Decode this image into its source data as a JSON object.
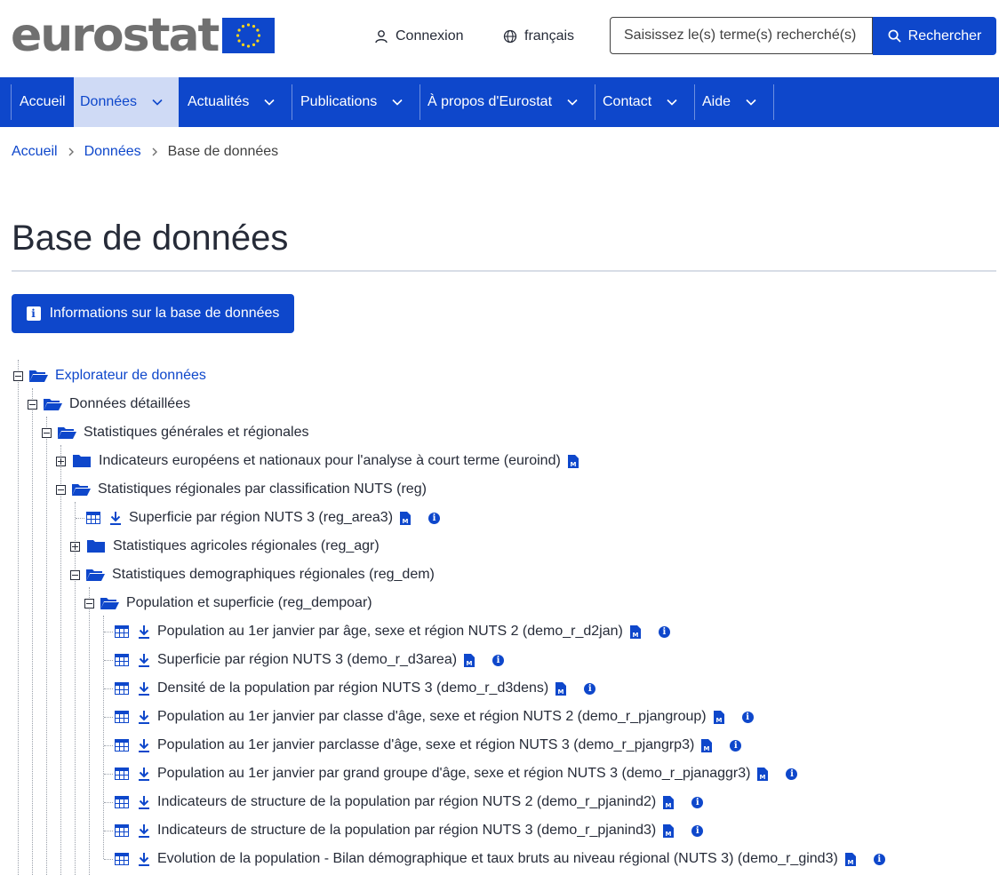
{
  "header": {
    "logo_text": "eurostat",
    "login_label": "Connexion",
    "language_label": "français",
    "search_placeholder": "Saisissez le(s) terme(s) recherché(s)",
    "search_button": "Rechercher"
  },
  "nav": {
    "items": [
      {
        "label": "Accueil"
      },
      {
        "label": "Données"
      },
      {
        "label": "Actualités"
      },
      {
        "label": "Publications"
      },
      {
        "label": "À propos d'Eurostat"
      },
      {
        "label": "Contact"
      },
      {
        "label": "Aide"
      }
    ]
  },
  "breadcrumb": {
    "items": [
      "Accueil",
      "Données",
      "Base de données"
    ]
  },
  "page_title": "Base de données",
  "info_button": "Informations sur la base de données",
  "tree": {
    "explorer": "Explorateur de données",
    "detailed": "Données détaillées",
    "general": "Statistiques générales et régionales",
    "euroind": "Indicateurs européens et nationaux pour l'analyse à court terme (euroind)",
    "reg": "Statistiques régionales par classification NUTS (reg)",
    "reg_area3": "Superficie par région NUTS 3 (reg_area3)",
    "reg_agr": "Statistiques agricoles régionales (reg_agr)",
    "reg_dem": "Statistiques demographiques régionales (reg_dem)",
    "reg_dempoar": "Population et superficie (reg_dempoar)",
    "datasets": [
      "Population au 1er janvier par âge, sexe et région NUTS 2 (demo_r_d2jan)",
      "Superficie par région NUTS 3 (demo_r_d3area)",
      "Densité de la population par région NUTS 3 (demo_r_d3dens)",
      "Population au 1er janvier par classe d'âge, sexe et région NUTS 2 (demo_r_pjangroup)",
      "Population au 1er janvier parclasse d'âge, sexe et région NUTS 3 (demo_r_pjangrp3)",
      "Population au 1er janvier par grand groupe d'âge, sexe et région NUTS 3 (demo_r_pjanaggr3)",
      "Indicateurs de structure de la population par région NUTS 2 (demo_r_pjanind2)",
      "Indicateurs de structure de la population par région NUTS 3 (demo_r_pjanind3)",
      "Evolution de la population - Bilan démographique et taux bruts au niveau régional (NUTS 3) (demo_r_gind3)"
    ]
  },
  "colors": {
    "primary": "#0e47cb",
    "active_nav_bg": "#cfdaf5",
    "text": "#262b38",
    "logo_grey": "#707070"
  }
}
